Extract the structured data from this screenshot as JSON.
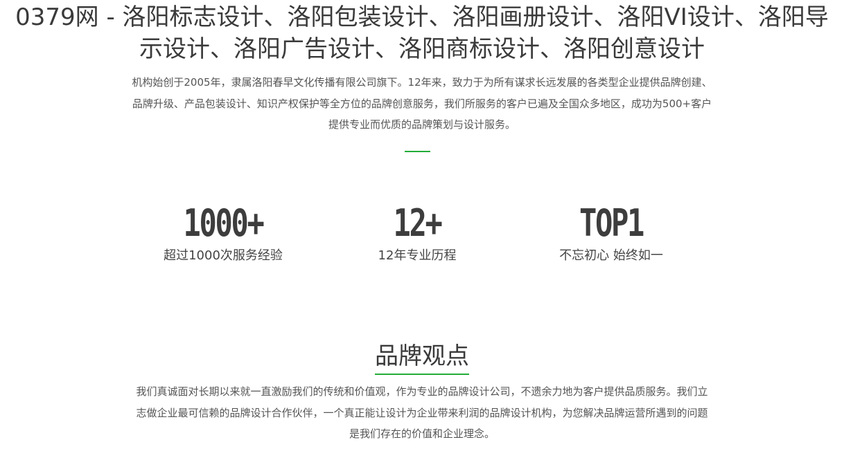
{
  "page_title": "0379网 - 洛阳标志设计、洛阳包装设计、洛阳画册设计、洛阳VI设计、洛阳导示设计、洛阳广告设计、洛阳商标设计、洛阳创意设计",
  "intro": "机构始创于2005年，隶属洛阳春早文化传播有限公司旗下。12年来，致力于为所有谋求长远发展的各类型企业提供品牌创建、品牌升级、产品包装设计、知识产权保护等全方位的品牌创意服务，我们所服务的客户已遍及全国众多地区，成功为500+客户提供专业而优质的品牌策划与设计服务。",
  "stats": [
    {
      "value": "1000+",
      "caption": "超过1000次服务经验"
    },
    {
      "value": "12+",
      "caption": "12年专业历程"
    },
    {
      "value": "TOP1",
      "caption": "不忘初心 始终如一"
    }
  ],
  "brand_section": {
    "heading": "品牌观点",
    "text": "我们真诚面对长期以来就一直激励我们的传统和价值观，作为专业的品牌设计公司，不遗余力地为客户提供品质服务。我们立志做企业最可信赖的品牌设计合作伙伴，一个真正能让设计为企业带来利润的品牌设计机构，为您解决品牌运营所遇到的问题是我们存在的价值和企业理念。"
  },
  "colors": {
    "accent": "#22ac38",
    "text": "#3a3a3a",
    "body_text": "#555555"
  }
}
